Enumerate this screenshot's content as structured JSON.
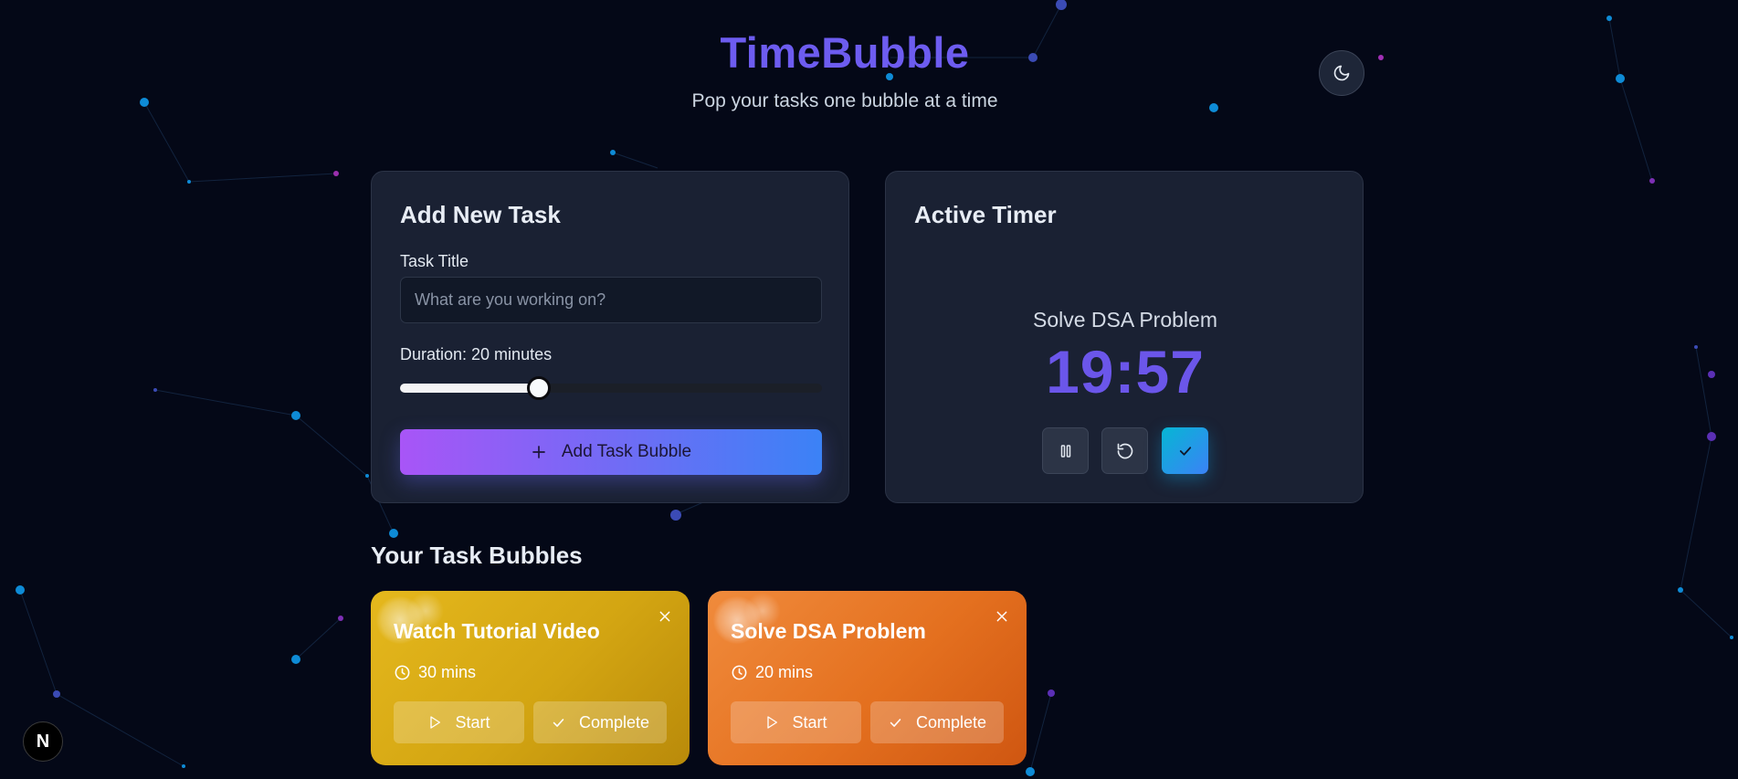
{
  "header": {
    "title": "TimeBubble",
    "subtitle": "Pop your tasks one bubble at a time",
    "theme_icon": "moon-icon"
  },
  "add_task": {
    "title": "Add New Task",
    "task_title_label": "Task Title",
    "task_title_placeholder": "What are you working on?",
    "task_title_value": "",
    "duration_label": "Duration: 20 minutes",
    "duration_fraction": 0.33,
    "button_label": "Add Task Bubble",
    "button_icon": "plus-icon"
  },
  "timer": {
    "title": "Active Timer",
    "task_name": "Solve DSA Problem",
    "time": "19:57",
    "controls": [
      "pause-icon",
      "reset-icon",
      "check-icon"
    ]
  },
  "bubbles": {
    "section_title": "Your Task Bubbles",
    "items": [
      {
        "title": "Watch Tutorial Video",
        "duration": "30 mins",
        "start_label": "Start",
        "complete_label": "Complete",
        "color": "#d6a815"
      },
      {
        "title": "Solve DSA Problem",
        "duration": "20 mins",
        "start_label": "Start",
        "complete_label": "Complete",
        "color": "#e4701f"
      }
    ]
  },
  "dev_badge": {
    "label": "N"
  }
}
